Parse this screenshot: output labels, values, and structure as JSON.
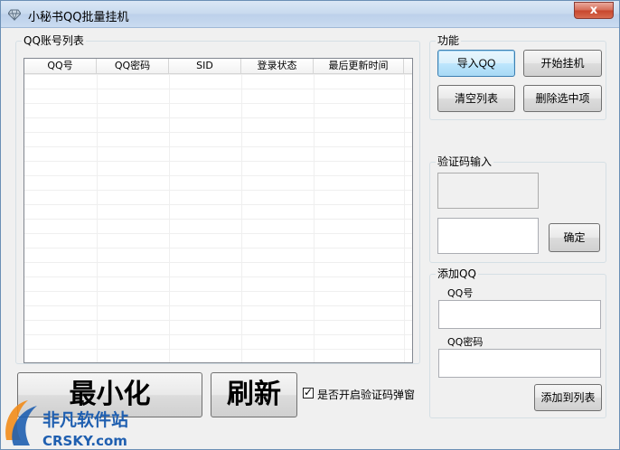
{
  "window": {
    "title": "小秘书QQ批量挂机",
    "close_glyph": "x"
  },
  "account_list": {
    "group_title": "QQ账号列表",
    "columns": [
      "QQ号",
      "QQ密码",
      "SID",
      "登录状态",
      "最后更新时间"
    ],
    "rows": []
  },
  "function_group": {
    "title": "功能",
    "import_label": "导入QQ",
    "start_label": "开始挂机",
    "clear_label": "清空列表",
    "delete_label": "删除选中项"
  },
  "captcha_group": {
    "title": "验证码输入",
    "confirm_label": "确定",
    "input_value": ""
  },
  "add_group": {
    "title": "添加QQ",
    "qq_label": "QQ号",
    "qq_value": "",
    "password_label": "QQ密码",
    "password_value": "",
    "add_label": "添加到列表"
  },
  "bottom": {
    "minimize_label": "最小化",
    "refresh_label": "刷新",
    "captcha_popup_label": "是否开启验证码弹窗",
    "captcha_popup_checked": true,
    "check_glyph": "✓"
  },
  "watermark": {
    "line1": "非凡软件站",
    "line2": "CRSKY.com"
  },
  "colors": {
    "close_red": "#c7452c",
    "watermark_blue": "#1f5fb0",
    "watermark_orange": "#f28c1a"
  }
}
